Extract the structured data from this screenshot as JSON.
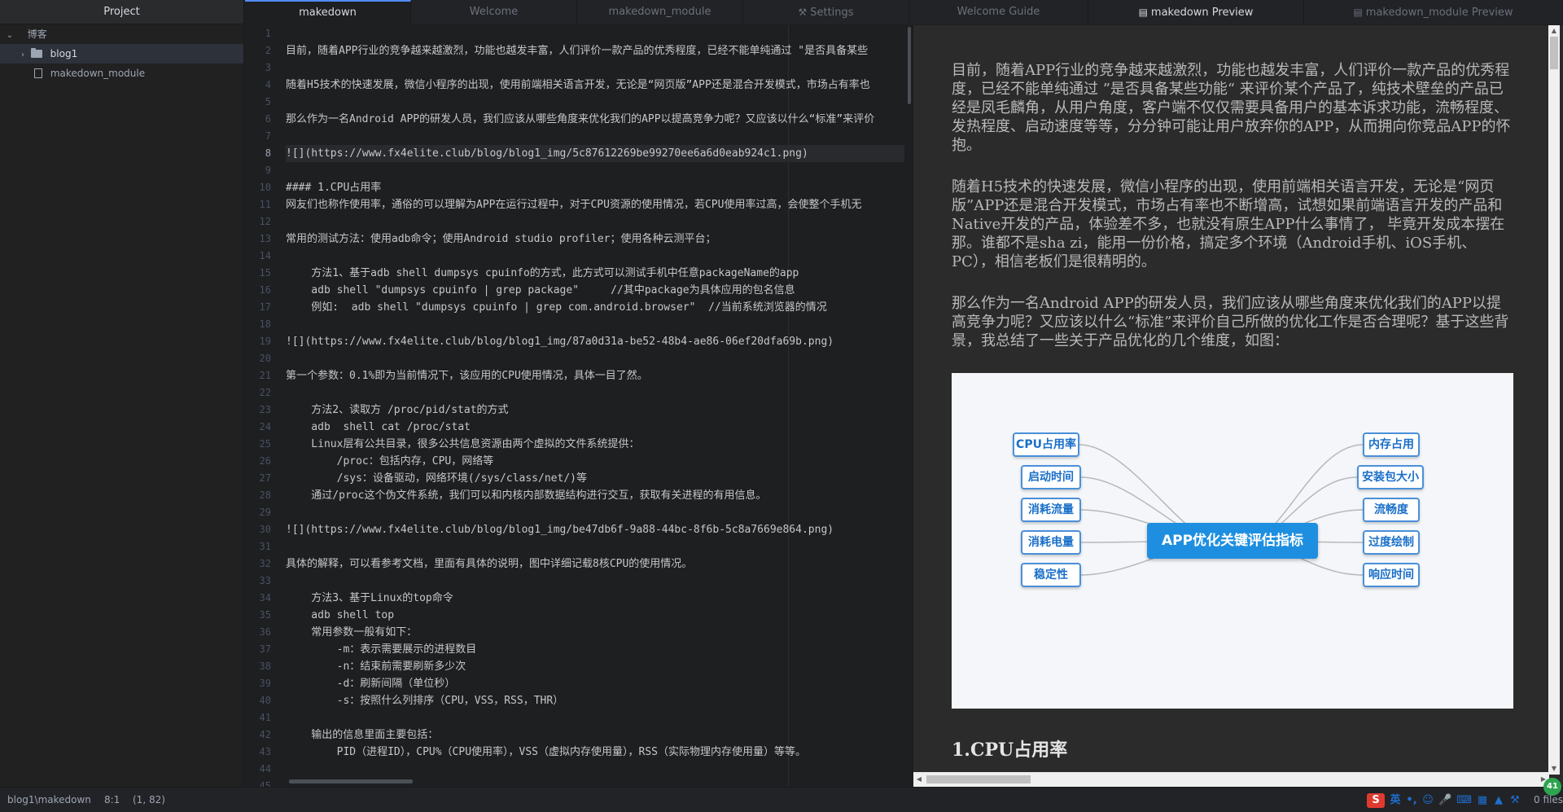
{
  "tree": {
    "tab_label": "Project",
    "root_label": "博客",
    "items": [
      {
        "label": "blog1",
        "type": "folder"
      },
      {
        "label": "makedown_module",
        "type": "file"
      }
    ]
  },
  "tabs": [
    {
      "label": "makedown",
      "icon": ""
    },
    {
      "label": "Welcome",
      "icon": ""
    },
    {
      "label": "makedown_module",
      "icon": ""
    },
    {
      "label": "Settings",
      "icon": "wrench-icon"
    },
    {
      "label": "Welcome Guide",
      "icon": ""
    },
    {
      "label": "makedown Preview",
      "icon": "preview-icon"
    },
    {
      "label": "makedown_module Preview",
      "icon": "preview-icon"
    }
  ],
  "editor": {
    "line_numbers": [
      "1",
      "2",
      "3",
      "4",
      "5",
      "6",
      "7",
      "8",
      "9",
      "10",
      "11",
      "12",
      "13",
      "14",
      "15",
      "16",
      "17",
      "18",
      "19",
      "20",
      "21",
      "22",
      "23",
      "24",
      "25",
      "26",
      "27",
      "28",
      "29",
      "30",
      "31",
      "32",
      "33",
      "34",
      "35",
      "36",
      "37",
      "38",
      "39",
      "40",
      "41",
      "42",
      "43",
      "44",
      "45"
    ],
    "lines": [
      "",
      "目前，随着APP行业的竞争越来越激烈，功能也越发丰富，人们评价一款产品的优秀程度，已经不能单纯通过 \"是否具备某些",
      "",
      "随着H5技术的快速发展，微信小程序的出现，使用前端相关语言开发，无论是“网页版”APP还是混合开发模式，市场占有率也",
      "",
      "那么作为一名Android APP的研发人员，我们应该从哪些角度来优化我们的APP以提高竞争力呢？又应该以什么“标准”来评价",
      "",
      "![](https://www.fx4elite.club/blog/blog1_img/5c87612269be99270ee6a6d0eab924c1.png)",
      "",
      "#### 1.CPU占用率",
      "网友们也称作使用率，通俗的可以理解为APP在运行过程中，对于CPU资源的使用情况，若CPU使用率过高，会使整个手机无",
      "",
      "常用的测试方法：使用adb命令；使用Android studio profiler；使用各种云测平台；",
      "",
      "    方法1、基于adb shell dumpsys cpuinfo的方式，此方式可以测试手机中任意packageName的app",
      "    adb shell \"dumpsys cpuinfo | grep package\"     //其中package为具体应用的包名信息",
      "    例如:  adb shell \"dumpsys cpuinfo | grep com.android.browser\"  //当前系统浏览器的情况",
      "",
      "![](https://www.fx4elite.club/blog/blog1_img/87a0d31a-be52-48b4-ae86-06ef20dfa69b.png)",
      "",
      "第一个参数：0.1%即为当前情况下，该应用的CPU使用情况，具体一目了然。",
      "",
      "    方法2、读取方 /proc/pid/stat的方式",
      "    adb  shell cat /proc/stat",
      "    Linux层有公共目录，很多公共信息资源由两个虚拟的文件系统提供：",
      "        /proc：包括内存，CPU，网络等",
      "        /sys：设备驱动，网络环境(/sys/class/net/)等",
      "    通过/proc这个伪文件系统，我们可以和内核内部数据结构进行交互，获取有关进程的有用信息。",
      "",
      "![](https://www.fx4elite.club/blog/blog1_img/be47db6f-9a88-44bc-8f6b-5c8a7669e864.png)",
      "",
      "具体的解释，可以看参考文档，里面有具体的说明，图中详细记载8核CPU的使用情况。",
      "",
      "    方法3、基于Linux的top命令",
      "    adb shell top",
      "    常用参数一般有如下：",
      "        -m：表示需要展示的进程数目",
      "        -n：结束前需要刷新多少次",
      "        -d：刷新间隔（单位秒）",
      "        -s：按照什么列排序（CPU，VSS，RSS，THR）",
      "",
      "    输出的信息里面主要包括：",
      "        PID（进程ID），CPU%（CPU使用率），VSS（虚拟内存使用量），RSS（实际物理内存使用量）等等。",
      "",
      ""
    ]
  },
  "preview": {
    "paragraphs": [
      "目前，随着APP行业的竞争越来越激烈，功能也越发丰富，人们评价一款产品的优秀程度，已经不能单纯通过 ”是否具备某些功能“ 来评价某个产品了，纯技术壁垒的产品已经是凤毛麟角，从用户角度，客户端不仅仅需要具备用户的基本诉求功能，流畅程度、发热程度、启动速度等等，分分钟可能让用户放弃你的APP，从而拥向你竞品APP的怀抱。",
      "随着H5技术的快速发展，微信小程序的出现，使用前端相关语言开发，无论是“网页版”APP还是混合开发模式，市场占有率也不断增高，试想如果前端语言开发的产品和Native开发的产品，体验差不多，也就没有原生APP什么事情了， 毕竟开发成本摆在那。谁都不是sha zi，能用一份价格，搞定多个环境（Android手机、iOS手机、PC），相信老板们是很精明的。",
      "那么作为一名Android APP的研发人员，我们应该从哪些角度来优化我们的APP以提高竞争力呢？又应该以什么“标准”来评价自己所做的优化工作是否合理呢？基于这些背景，我总结了一些关于产品优化的几个维度，如图："
    ],
    "mindmap": {
      "center": "APP优化关键评估指标",
      "left": [
        "CPU占用率",
        "启动时间",
        "消耗流量",
        "消耗电量",
        "稳定性"
      ],
      "right": [
        "内存占用",
        "安装包大小",
        "流畅度",
        "过度绘制",
        "响应时间"
      ]
    },
    "heading": "1.CPU占用率"
  },
  "status": {
    "path": "blog1\\makedown",
    "cursor": "8:1",
    "selection": "(1, 82)",
    "ime_lang": "英",
    "files": "0 files",
    "badge": "41"
  }
}
